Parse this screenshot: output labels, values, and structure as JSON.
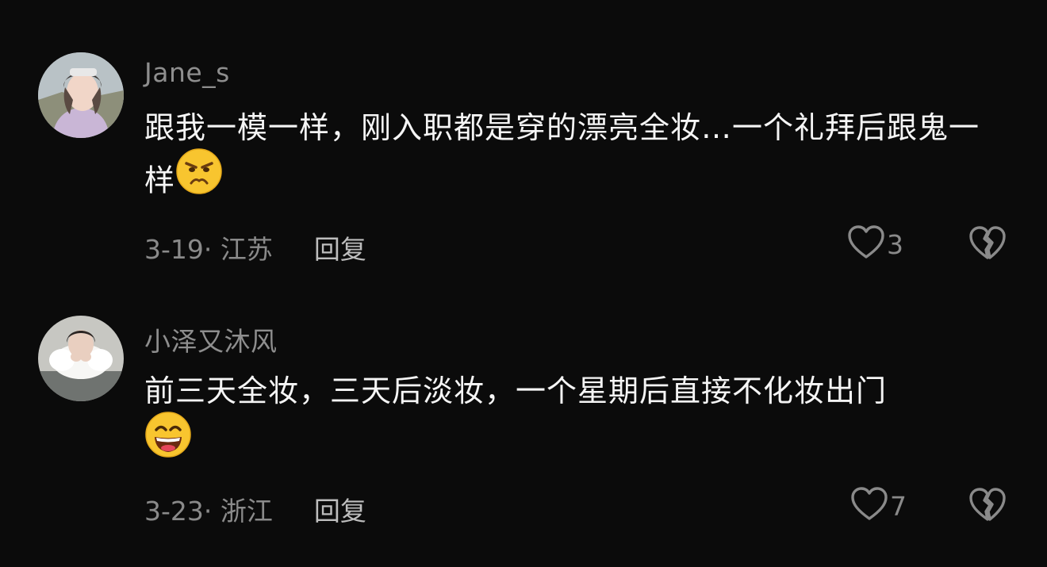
{
  "comments": [
    {
      "username": "Jane_s",
      "text": "跟我一模一样，刚入职都是穿的漂亮全妆…一个礼拜后跟鬼一样",
      "emoji": "frowning-face-emoji",
      "date": "3-19",
      "location": "江苏",
      "reply_label": "回复",
      "likes": "3"
    },
    {
      "username": "小泽又沐风",
      "text": "前三天全妆，三天后淡妆，一个星期后直接不化妆出门",
      "emoji": "grinning-face-emoji",
      "date": "3-23",
      "location": "浙江",
      "reply_label": "回复",
      "likes": "7"
    }
  ],
  "icons": {
    "like": "heart-outline-icon",
    "dislike": "broken-heart-icon"
  },
  "colors": {
    "background": "#0b0b0b",
    "text": "#f5f5f5",
    "muted": "#8a8a8a",
    "emoji_yellow": "#f8c52f"
  }
}
